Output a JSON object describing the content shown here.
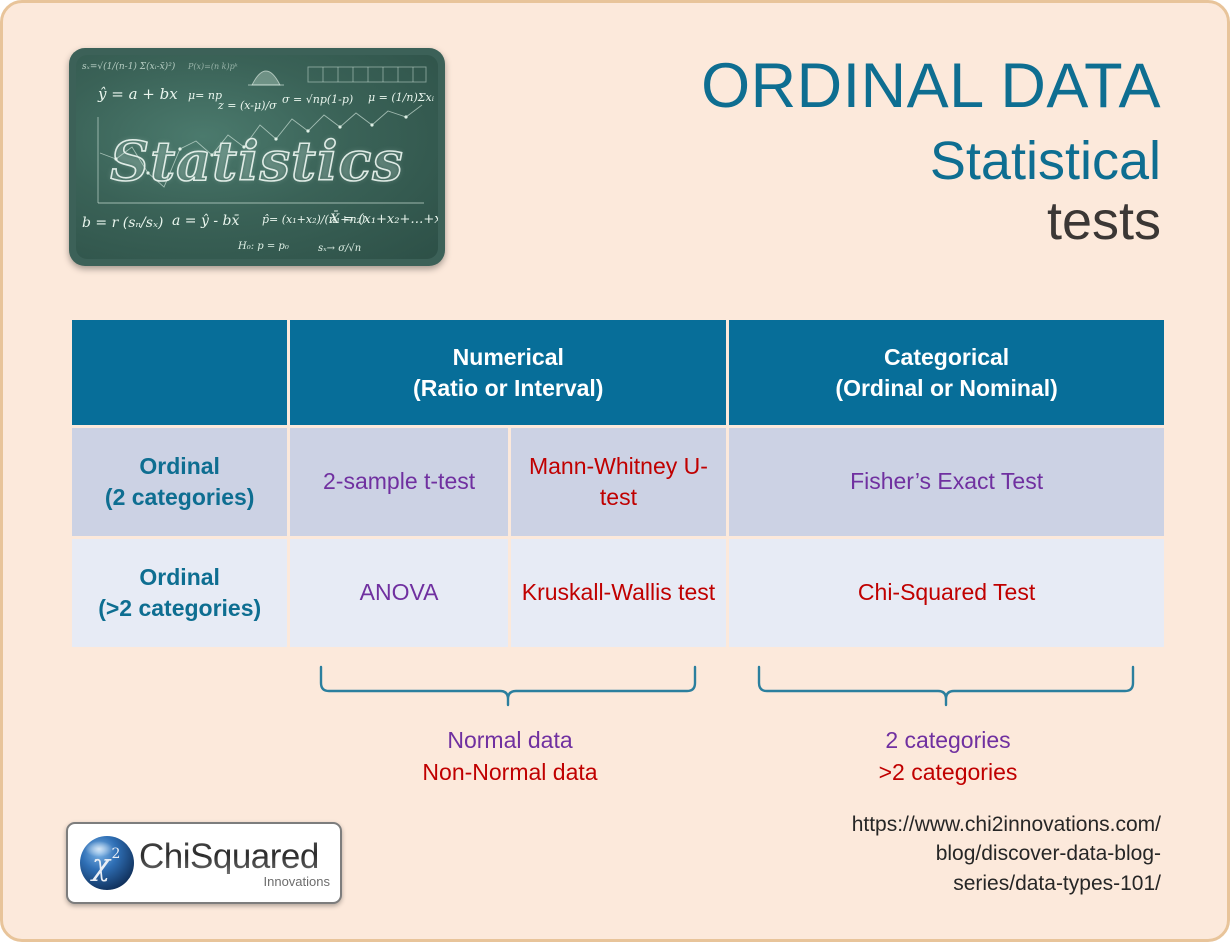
{
  "slide": {
    "background_color": "#fce9db",
    "border_color": "#e8c49a"
  },
  "hero_image": {
    "name": "statistics-chalkboard",
    "chalk_title": "Statistics",
    "board_color": "#3a6257"
  },
  "title": {
    "main": "ORDINAL DATA",
    "sub_line1": "Statistical",
    "sub_line2": "tests",
    "main_color": "#0e6e91",
    "sub2_color": "#3b3735"
  },
  "table": {
    "header_color": "#076e99",
    "row1_color": "#ccd2e4",
    "row2_color": "#e7ebf5",
    "corner_label": "",
    "headers": [
      {
        "line1": "Numerical",
        "line2": "(Ratio or Interval)"
      },
      {
        "line1": "Categorical",
        "line2": "(Ordinal or Nominal)"
      }
    ],
    "rows": [
      {
        "label_line1": "Ordinal",
        "label_line2": "(2 categories)",
        "numerical_normal": "2-sample t-test",
        "numerical_nonnormal": "Mann-Whitney U-test",
        "categorical": "Fisher’s Exact Test",
        "numerical_normal_color": "#7030a0",
        "numerical_nonnormal_color": "#c00000",
        "categorical_color": "#7030a0"
      },
      {
        "label_line1": "Ordinal",
        "label_line2": "(>2 categories)",
        "numerical_normal": "ANOVA",
        "numerical_nonnormal": "Kruskall-Wallis test",
        "categorical": "Chi-Squared Test",
        "numerical_normal_color": "#7030a0",
        "numerical_nonnormal_color": "#c00000",
        "categorical_color": "#c00000"
      }
    ]
  },
  "braces": {
    "color": "#2b7f9e",
    "left_caption": {
      "line1": "Normal data",
      "line2": "Non-Normal data"
    },
    "right_caption": {
      "line1": "2 categories",
      "line2": ">2 categories"
    }
  },
  "source_url": {
    "line1": "https://www.chi2innovations.com/",
    "line2": "blog/discover-data-blog-",
    "line3": "series/data-types-101/"
  },
  "logo": {
    "symbol": "χ",
    "exponent": "2",
    "name": "ChiSquared",
    "tagline": "Innovations"
  }
}
